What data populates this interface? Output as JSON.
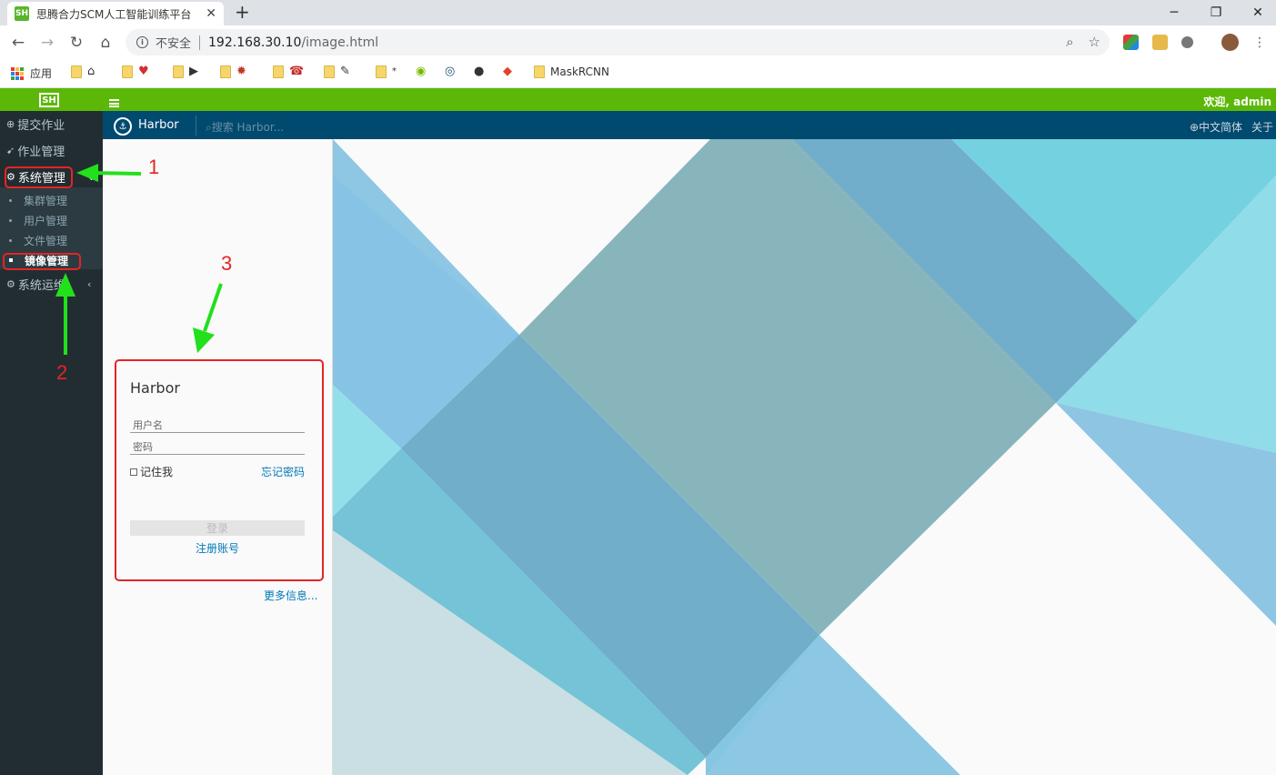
{
  "browser": {
    "tab_title": "思腾合力SCM人工智能训练平台",
    "tab_favicon_text": "SH",
    "security_label": "不安全",
    "url_host": "192.168.30.10",
    "url_path": "/image.html",
    "window_controls": {
      "minimize": "─",
      "restore": "❐",
      "close": "✕"
    },
    "bookmarks": {
      "apps_label": "应用",
      "folder_extra_glyph": "*",
      "maskrcnn_label": "MaskRCNN"
    }
  },
  "app": {
    "logo_text": "SH",
    "welcome": "欢迎, admin",
    "sidebar": {
      "items": [
        {
          "label": "提交作业",
          "icon": "⊕"
        },
        {
          "label": "作业管理",
          "icon": "➹"
        },
        {
          "label": "系统管理",
          "icon": "⚙",
          "caret": "⌄"
        },
        {
          "label": "系统运维",
          "icon": "⚙",
          "caret": "‹"
        }
      ],
      "submenu": [
        {
          "label": "集群管理"
        },
        {
          "label": "用户管理"
        },
        {
          "label": "文件管理"
        },
        {
          "label": "镜像管理",
          "active": true
        }
      ]
    }
  },
  "harbor": {
    "brand": "Harbor",
    "search_placeholder": "搜索 Harbor...",
    "language": "⊕中文简体",
    "about": "关于",
    "login": {
      "title": "Harbor",
      "username_placeholder": "用户名",
      "password_placeholder": "密码",
      "remember_me": "记住我",
      "forgot_password": "忘记密码",
      "login_button": "登录",
      "signup": "注册账号",
      "more_info": "更多信息..."
    }
  },
  "annotations": [
    "1",
    "2",
    "3"
  ],
  "colors": {
    "app_green": "#5cb808",
    "sidebar_dark": "#222d32",
    "harbor_header": "#004a70",
    "link_blue": "#0079b8",
    "annotation_red": "#e52424",
    "annotation_arrow": "#22e01c"
  }
}
